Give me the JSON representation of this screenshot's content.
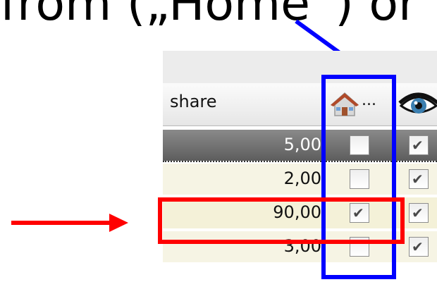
{
  "caption_text": "from („Home“) or",
  "table": {
    "header": {
      "share_label": "share",
      "ellipsis": "...",
      "home_icon": "house-icon",
      "eye_icon": "eye-icon"
    },
    "rows": [
      {
        "share": "5,00",
        "home_checked": false,
        "eye_checked": true,
        "state": "selected"
      },
      {
        "share": "2,00",
        "home_checked": false,
        "eye_checked": true,
        "state": "normal"
      },
      {
        "share": "90,00",
        "home_checked": true,
        "eye_checked": true,
        "state": "highlighted"
      },
      {
        "share": "3,00",
        "home_checked": false,
        "eye_checked": true,
        "state": "normal"
      }
    ],
    "check_glyph": "✔"
  },
  "annotations": {
    "blue_color": "#0000ff",
    "red_color": "#ff0000"
  }
}
